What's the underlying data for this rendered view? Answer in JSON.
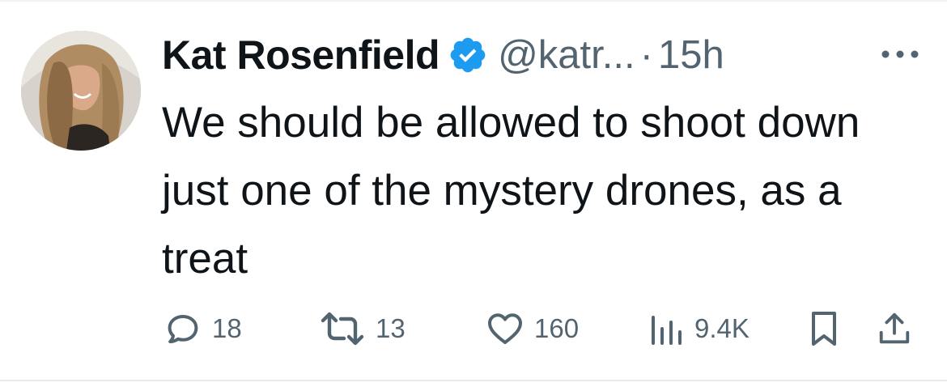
{
  "tweet": {
    "author": {
      "display_name": "Kat Rosenfield",
      "handle": "@katr...",
      "verified": true
    },
    "separator": "·",
    "timestamp": "15h",
    "text": "We should be allowed to shoot down just one of the mystery drones, as a treat",
    "stats": {
      "replies": "18",
      "reposts": "13",
      "likes": "160",
      "views": "9.4K"
    }
  },
  "colors": {
    "text_primary": "#0f1419",
    "text_secondary": "#536471",
    "verified_badge": "#1d9bf0"
  },
  "icons": {
    "verified": "verified-badge-icon",
    "more": "more-options-icon",
    "reply": "reply-icon",
    "repost": "repost-icon",
    "like": "heart-icon",
    "views": "views-chart-icon",
    "bookmark": "bookmark-icon",
    "share": "share-icon"
  }
}
